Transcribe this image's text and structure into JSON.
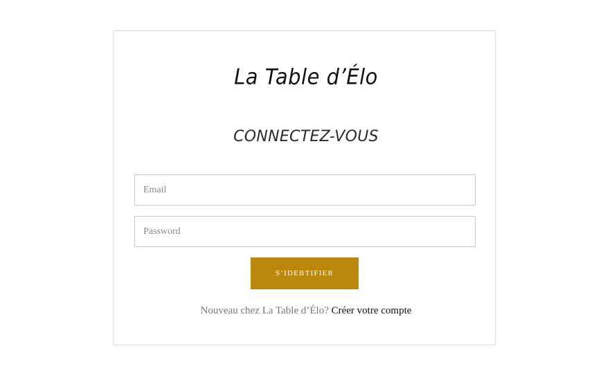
{
  "brand": {
    "name": "La Table d’Élo"
  },
  "login": {
    "heading": "Connectez-vous",
    "email_placeholder": "Email",
    "password_placeholder": "Password",
    "submit_label": "S’idebtifier"
  },
  "signup": {
    "prompt": "Nouveau chez La Table d’Élo? ",
    "link_label": "Créer votre compte"
  },
  "colors": {
    "accent": "#bb870c",
    "border": "#dcdcdc",
    "background": "#ffffff"
  }
}
